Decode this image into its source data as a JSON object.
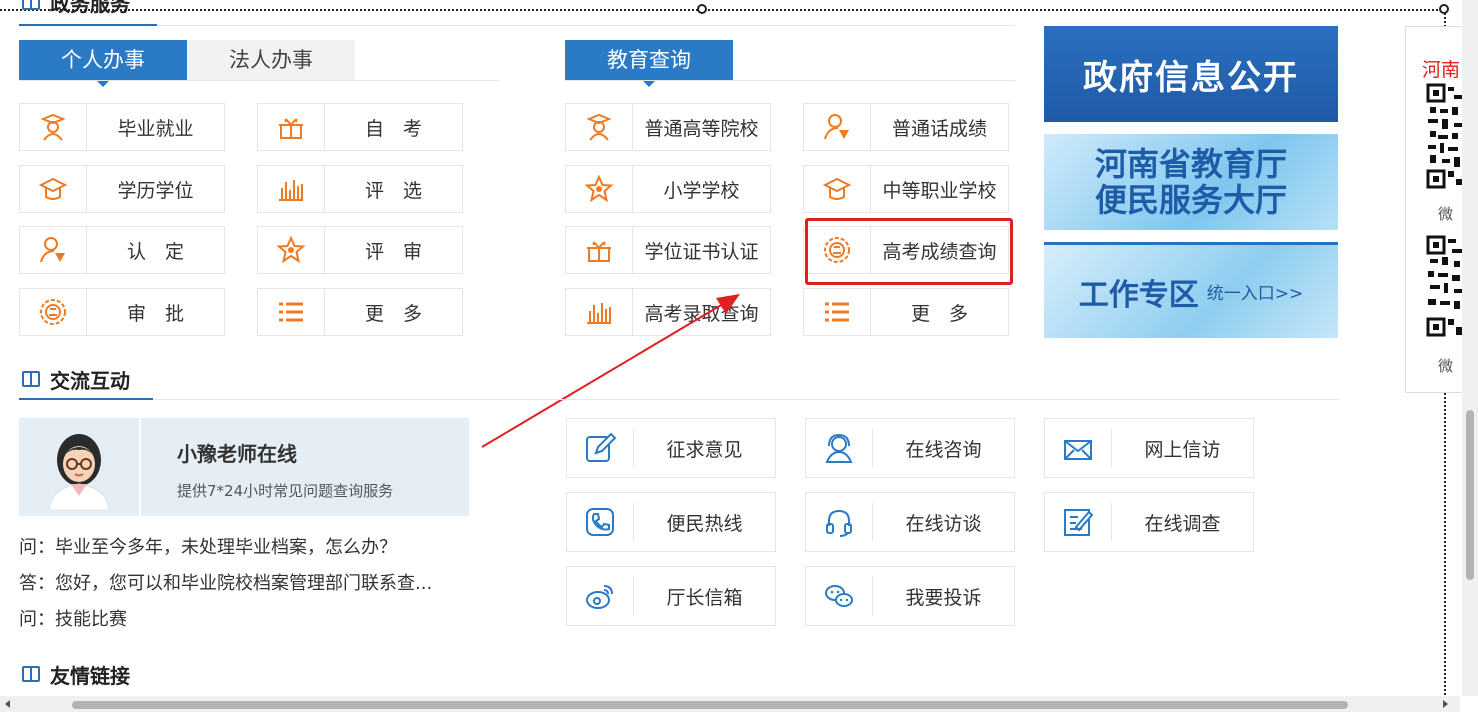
{
  "top_section": {
    "title": "政务服务"
  },
  "personal": {
    "tabs": [
      {
        "label": "个人办事"
      },
      {
        "label": "法人办事"
      }
    ],
    "items": [
      {
        "label": "毕业就业"
      },
      {
        "label": "自　考"
      },
      {
        "label": "学历学位"
      },
      {
        "label": "评　选"
      },
      {
        "label": "认　定"
      },
      {
        "label": "评　审"
      },
      {
        "label": "审　批"
      },
      {
        "label": "更　多"
      }
    ]
  },
  "education": {
    "tab": "教育查询",
    "items": [
      {
        "label": "普通高等院校"
      },
      {
        "label": "普通话成绩"
      },
      {
        "label": "小学学校"
      },
      {
        "label": "中等职业学校"
      },
      {
        "label": "学位证书认证"
      },
      {
        "label": "高考成绩查询"
      },
      {
        "label": "高考录取查询"
      },
      {
        "label": "更　多"
      }
    ]
  },
  "banners": {
    "gov_info": "政府信息公开",
    "service_hall_line1": "河南省教育厅",
    "service_hall_line2": "便民服务大厅",
    "work_zone": "工作专区",
    "work_zone_sub": "统一入口>>"
  },
  "sidebar_qr": {
    "heading": "河南",
    "caption1": "微",
    "caption2": "微"
  },
  "interaction": {
    "title": "交流互动",
    "assistant_name": "小豫老师在线",
    "assistant_desc": "提供7*24小时常见问题查询服务",
    "qa": [
      "问：毕业至今多年，未处理毕业档案，怎么办？",
      "答：您好，您可以和毕业院校档案管理部门联系查...",
      "问：技能比赛"
    ],
    "items": [
      {
        "label": "征求意见"
      },
      {
        "label": "在线咨询"
      },
      {
        "label": "网上信访"
      },
      {
        "label": "便民热线"
      },
      {
        "label": "在线访谈"
      },
      {
        "label": "在线调查"
      },
      {
        "label": "厅长信箱"
      },
      {
        "label": "我要投诉"
      }
    ]
  },
  "links": {
    "title": "友情链接"
  },
  "colors": {
    "accent_blue": "#2a7ac6",
    "icon_orange": "#f07a22",
    "highlight_red": "#e02020"
  }
}
